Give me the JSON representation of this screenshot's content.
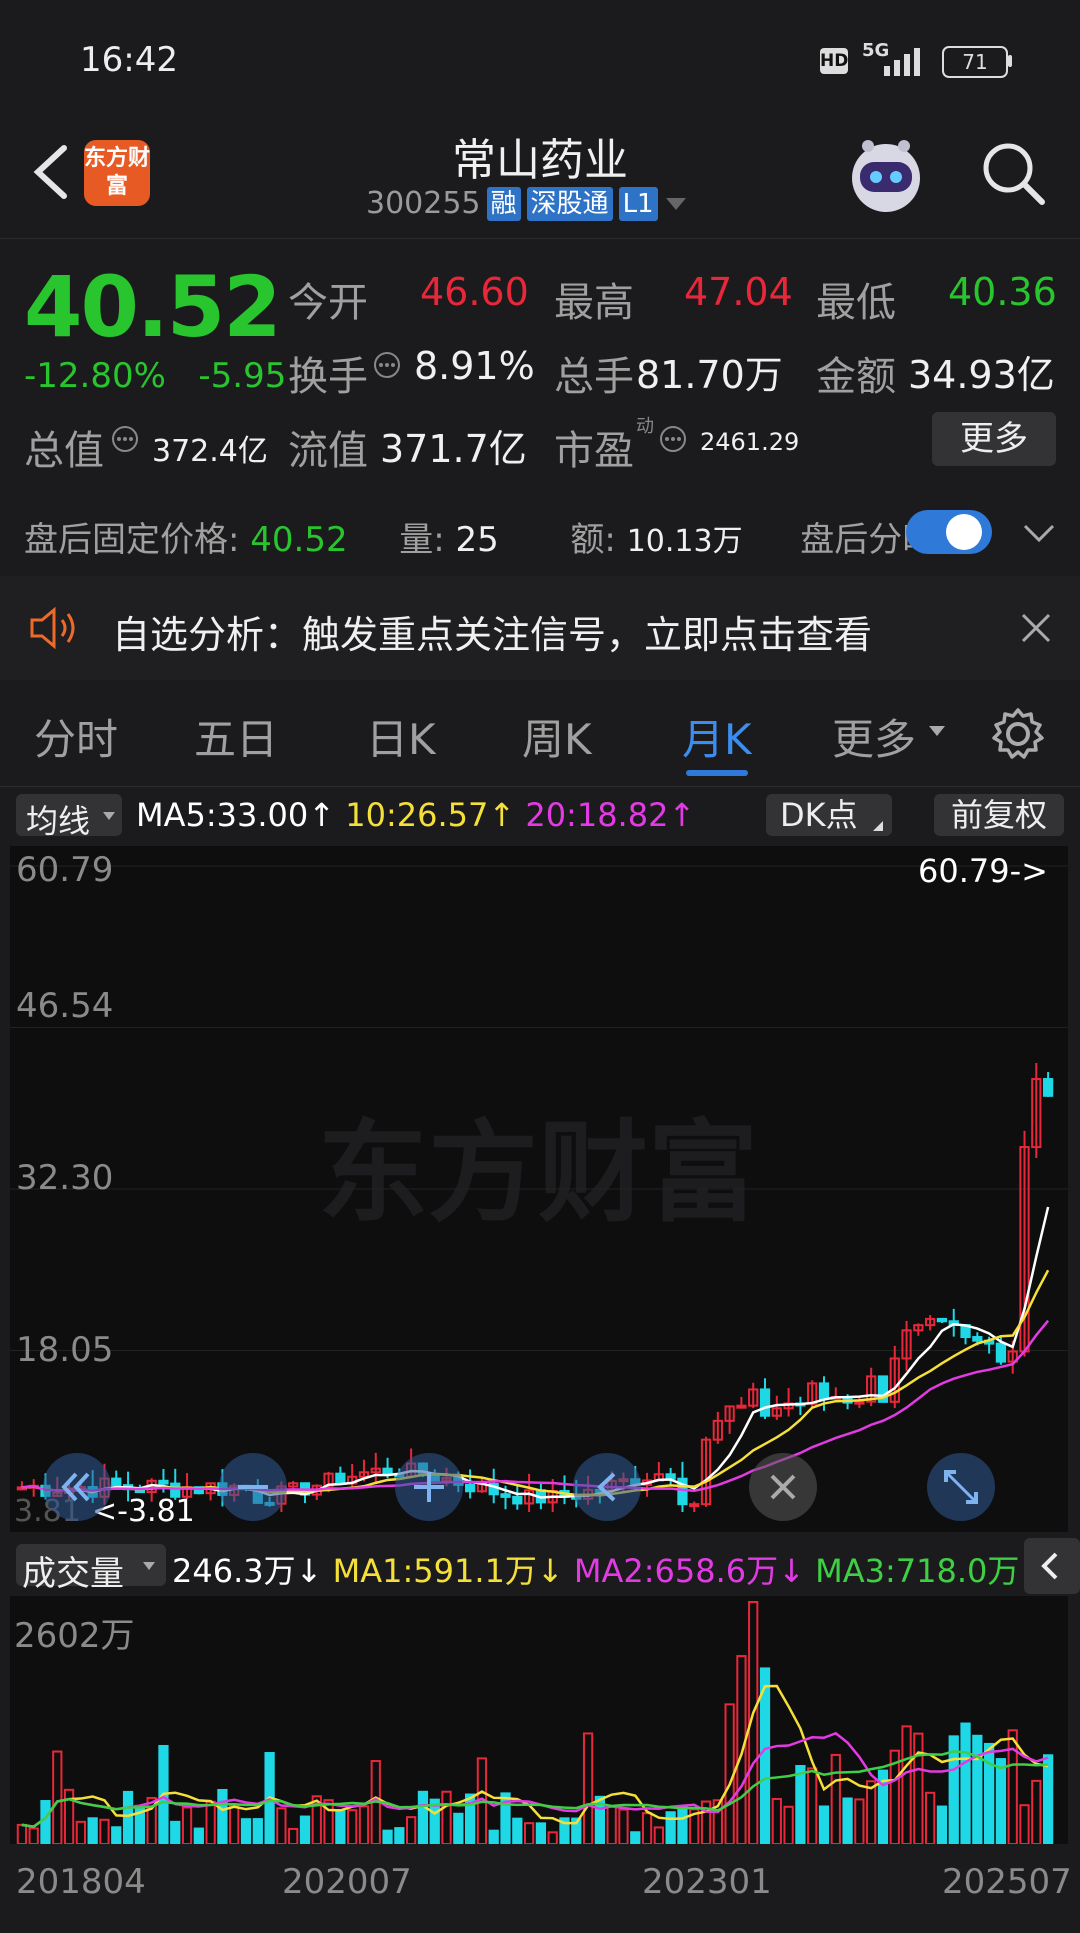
{
  "status_bar": {
    "time": "16:42",
    "hd": "HD",
    "net": "5G",
    "battery": "71"
  },
  "header": {
    "logo": "东方财富",
    "title": "常山药业",
    "code": "300255",
    "tags": [
      "融",
      "深股通",
      "L1"
    ]
  },
  "quote": {
    "price": "40.52",
    "change_pct": "-12.80%",
    "change_abs": "-5.95",
    "open_label": "今开",
    "open_value": "46.60",
    "high_label": "最高",
    "high_value": "47.04",
    "low_label": "最低",
    "low_value": "40.36",
    "turnover_label": "换手",
    "turnover_value": "8.91%",
    "volume_label": "总手",
    "volume_value": "81.70万",
    "amount_label": "金额",
    "amount_value": "34.93亿",
    "mktcap_label": "总值",
    "mktcap_value": "372.4亿",
    "float_label": "流值",
    "float_value": "371.7亿",
    "pe_label": "市盈",
    "pe_sup": "动",
    "pe_value": "2461.29",
    "more_button": "更多"
  },
  "after_hours": {
    "price_label": "盘后固定价格:",
    "price_value": "40.52",
    "vol_label": "量:",
    "vol_value": "25",
    "amt_label": "额:",
    "amt_value": "10.13万",
    "toggle_label": "盘后分时",
    "toggle_on": true
  },
  "banner": {
    "text": "自选分析：触发重点关注信号，立即点击查看"
  },
  "tabs": [
    {
      "label": "分时"
    },
    {
      "label": "五日"
    },
    {
      "label": "日K"
    },
    {
      "label": "周K"
    },
    {
      "label": "月K",
      "active": true
    },
    {
      "label": "更多"
    }
  ],
  "ma_bar": {
    "selector": "均线",
    "ma5": "MA5:33.00",
    "ma10": "10:26.57",
    "ma20": "20:18.82",
    "dk": "DK点",
    "adjust": "前复权"
  },
  "colors": {
    "up": "#e8283a",
    "down": "#1fd8e6",
    "ma5": "#ffffff",
    "ma10": "#f5e03a",
    "ma20": "#e33be3",
    "ma3": "#3fcf45",
    "accent": "#2f7ad8"
  },
  "price_axis": {
    "labels": [
      "60.79",
      "46.54",
      "32.30",
      "18.05"
    ],
    "max_label": "60.79->",
    "min_label": "<-3.81",
    "min_left": "3.81"
  },
  "volume_bar": {
    "selector": "成交量",
    "vol": "246.3万",
    "ma1": "MA1:591.1万",
    "ma2": "MA2:658.6万",
    "ma3": "MA3:718.0万",
    "axis_max": "2602万"
  },
  "x_axis": {
    "labels": [
      "201804",
      "202007",
      "202301",
      "202507"
    ]
  },
  "chart_data": {
    "type": "candlestick",
    "title": "",
    "ylim": [
      3.81,
      60.79
    ],
    "watermark": "东方财富",
    "x_range": [
      "201804",
      "202507"
    ],
    "price_max": 60.79,
    "price_min": 3.81,
    "last": {
      "open": 46.6,
      "high": 47.04,
      "low": 40.36,
      "close": 40.52
    },
    "ma_last": {
      "MA5": 33.0,
      "MA10": 26.57,
      "MA20": 18.82
    },
    "volume_max": "2602万",
    "volume_ma_last": {
      "MA1": "591.1万",
      "MA2": "658.6万",
      "MA3": "718.0万"
    }
  }
}
